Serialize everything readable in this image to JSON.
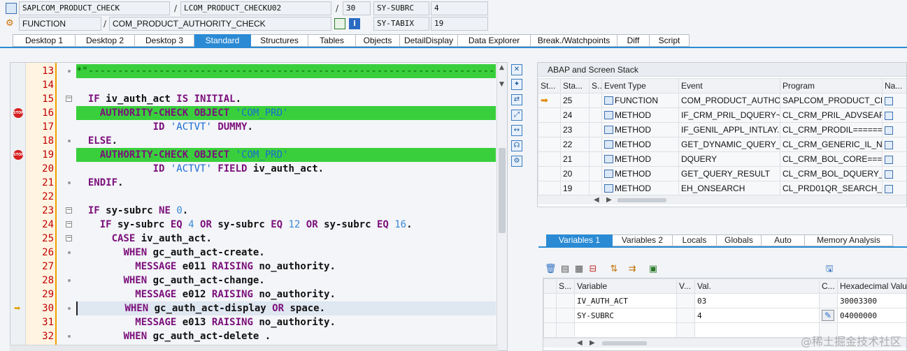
{
  "header": {
    "program": "SAPLCOM_PRODUCT_CHECK",
    "include": "LCOM_PRODUCT_CHECKU02",
    "line_no": "30",
    "sy_subrc_label": "SY-SUBRC",
    "sy_subrc_value": "4",
    "type": "FUNCTION",
    "function_name": "COM_PRODUCT_AUTHORITY_CHECK",
    "sy_tabix_label": "SY-TABIX",
    "sy_tabix_value": "19",
    "slash": "/"
  },
  "tabs": [
    "Desktop 1",
    "Desktop 2",
    "Desktop 3",
    "Standard",
    "Structures",
    "Tables",
    "Objects",
    "DetailDisplay",
    "Data Explorer",
    "Break./Watchpoints",
    "Diff",
    "Script"
  ],
  "active_tab": "Standard",
  "code_lines": [
    {
      "n": "13",
      "html": "<span class='cmt'>*\"--------------------------------------------------------------------------</span>",
      "hl": "cmt"
    },
    {
      "n": "14",
      "html": ""
    },
    {
      "n": "15",
      "html": "  <span class='kw'>IF</span> iv_auth_act <span class='kw'>IS INITIAL</span>."
    },
    {
      "n": "16",
      "html": "    <span class='kw'>AUTHORITY-CHECK OBJECT</span> <span class='str'>'COM_PRD'</span>",
      "hl": "green",
      "bp": true
    },
    {
      "n": "17",
      "html": "             <span class='kw'>ID</span> <span class='str'>'ACTVT'</span> <span class='kw'>DUMMY</span>."
    },
    {
      "n": "18",
      "html": "  <span class='kw'>ELSE</span>."
    },
    {
      "n": "19",
      "html": "    <span class='kw'>AUTHORITY-CHECK OBJECT</span> <span class='str'>'COM_PRD'</span>",
      "hl": "green",
      "bp": true
    },
    {
      "n": "20",
      "html": "             <span class='kw'>ID</span> <span class='str'>'ACTVT'</span> <span class='kw'>FIELD</span> iv_auth_act."
    },
    {
      "n": "21",
      "html": "  <span class='kw'>ENDIF</span>."
    },
    {
      "n": "22",
      "html": ""
    },
    {
      "n": "23",
      "html": "  <span class='kw'>IF</span> sy-subrc <span class='kw'>NE</span> <span class='num'>0</span>."
    },
    {
      "n": "24",
      "html": "    <span class='kw'>IF</span> sy-subrc <span class='kw'>EQ</span> <span class='num'>4</span> <span class='kw'>OR</span> sy-subrc <span class='kw'>EQ</span> <span class='num'>12</span> <span class='kw'>OR</span> sy-subrc <span class='kw'>EQ</span> <span class='num'>16</span>."
    },
    {
      "n": "25",
      "html": "      <span class='kw'>CASE</span> iv_auth_act."
    },
    {
      "n": "26",
      "html": "        <span class='kw'>WHEN</span> gc_auth_act-create."
    },
    {
      "n": "27",
      "html": "          <span class='kw'>MESSAGE</span> e011 <span class='kw'>RAISING</span> no_authority."
    },
    {
      "n": "28",
      "html": "        <span class='kw'>WHEN</span> gc_auth_act-change."
    },
    {
      "n": "29",
      "html": "          <span class='kw'>MESSAGE</span> e012 <span class='kw'>RAISING</span> no_authority."
    },
    {
      "n": "30",
      "html": "        <span class='kw'>WHEN</span> gc_auth_act-display <span class='kw'>OR</span> space.",
      "hl": "cur",
      "arrow": true
    },
    {
      "n": "31",
      "html": "          <span class='kw'>MESSAGE</span> e013 <span class='kw'>RAISING</span> no_authority."
    },
    {
      "n": "32",
      "html": "        <span class='kw'>WHEN</span> gc_auth_act-delete ."
    }
  ],
  "stack": {
    "title": "ABAP and Screen Stack",
    "columns": [
      "St...",
      "Sta...",
      "S...",
      "Event Type",
      "Event",
      "Program",
      "Na..."
    ],
    "rows": [
      {
        "level": "25",
        "type": "FUNCTION",
        "event": "COM_PRODUCT_AUTHO...",
        "program": "SAPLCOM_PRODUCT_CH...",
        "current": true
      },
      {
        "level": "24",
        "type": "METHOD",
        "event": "IF_CRM_PRIL_DQUERY~...",
        "program": "CL_CRM_PRIL_ADVSEAR..."
      },
      {
        "level": "23",
        "type": "METHOD",
        "event": "IF_GENIL_APPL_INTLAY...",
        "program": "CL_CRM_PRODIL======..."
      },
      {
        "level": "22",
        "type": "METHOD",
        "event": "GET_DYNAMIC_QUERY_...",
        "program": "CL_CRM_GENERIC_IL_NE..."
      },
      {
        "level": "21",
        "type": "METHOD",
        "event": "DQUERY",
        "program": "CL_CRM_BOL_CORE====..."
      },
      {
        "level": "20",
        "type": "METHOD",
        "event": "GET_QUERY_RESULT",
        "program": "CL_CRM_BOL_DQUERY_..."
      },
      {
        "level": "19",
        "type": "METHOD",
        "event": "EH_ONSEARCH",
        "program": "CL_PRD01QR_SEARCH_I..."
      }
    ]
  },
  "var_tabs": [
    "Variables 1",
    "Variables 2",
    "Locals",
    "Globals",
    "Auto",
    "Memory Analysis"
  ],
  "active_var_tab": "Variables 1",
  "vars": {
    "columns": [
      "S...",
      "Variable",
      "V...",
      "Val.",
      "C...",
      "Hexadecimal Valu"
    ],
    "rows": [
      {
        "name": "IV_AUTH_ACT",
        "value": "03",
        "hex": "30003300"
      },
      {
        "name": "SY-SUBRC",
        "value": "4",
        "hex": "04000000"
      }
    ]
  },
  "watermark": "@稀土掘金技术社区",
  "colors": {
    "accent": "#2a8ad4",
    "highlight": "#39cf3c",
    "linenum": "#c00000"
  }
}
